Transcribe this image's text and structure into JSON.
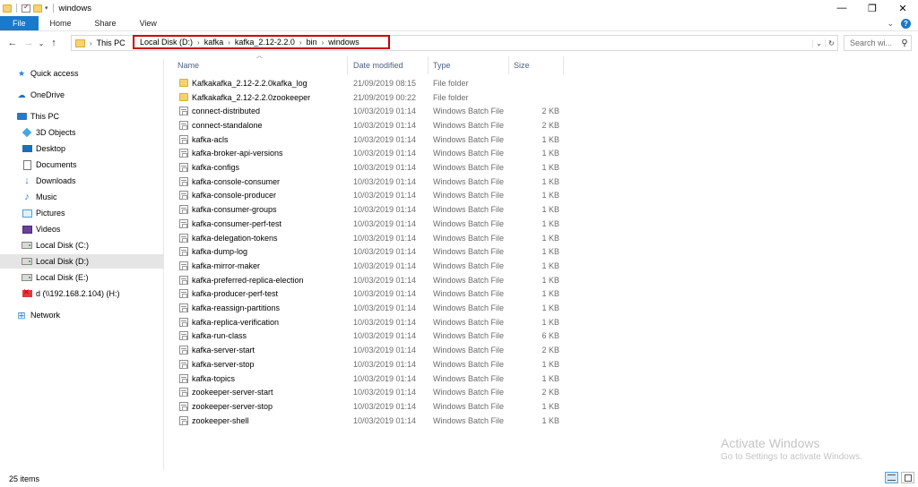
{
  "window": {
    "title": "windows",
    "controls": {
      "minimize": "—",
      "maximize": "❐",
      "close": "✕"
    }
  },
  "ribbon": {
    "tabs": [
      "File",
      "Home",
      "Share",
      "View"
    ],
    "expand": "⌄",
    "help": "?"
  },
  "nav": {
    "back": "←",
    "forward": "→",
    "recent": "⌄",
    "up": "↑"
  },
  "address": {
    "root": "This PC",
    "crumbs": [
      "Local Disk (D:)",
      "kafka",
      "kafka_2.12-2.2.0",
      "bin",
      "windows"
    ],
    "separator": "›",
    "dropdown": "⌄",
    "refresh": "↻",
    "highlight_color": "#cc0000"
  },
  "search": {
    "placeholder": "Search wi...",
    "icon": "search-icon"
  },
  "sidebar": {
    "items": [
      {
        "label": "Quick access",
        "icon": "star-icon"
      },
      {
        "label": "OneDrive",
        "icon": "cloud-icon"
      },
      {
        "label": "This PC",
        "icon": "computer-icon"
      },
      {
        "label": "3D Objects",
        "icon": "cube-icon"
      },
      {
        "label": "Desktop",
        "icon": "desktop-icon"
      },
      {
        "label": "Documents",
        "icon": "document-icon"
      },
      {
        "label": "Downloads",
        "icon": "download-icon"
      },
      {
        "label": "Music",
        "icon": "music-icon"
      },
      {
        "label": "Pictures",
        "icon": "picture-icon"
      },
      {
        "label": "Videos",
        "icon": "video-icon"
      },
      {
        "label": "Local Disk (C:)",
        "icon": "drive-icon"
      },
      {
        "label": "Local Disk (D:)",
        "icon": "drive-icon",
        "selected": true
      },
      {
        "label": "Local Disk (E:)",
        "icon": "drive-icon"
      },
      {
        "label": "d (\\\\192.168.2.104) (H:)",
        "icon": "network-drive-icon"
      },
      {
        "label": "Network",
        "icon": "network-icon"
      }
    ]
  },
  "columns": {
    "name": "Name",
    "date": "Date modified",
    "type": "Type",
    "size": "Size"
  },
  "files": [
    {
      "name": "Kafkakafka_2.12-2.2.0kafka_log",
      "date": "21/09/2019 08:15",
      "type": "File folder",
      "size": "",
      "icon": "folder-icon"
    },
    {
      "name": "Kafkakafka_2.12-2.2.0zookeeper",
      "date": "21/09/2019 00:22",
      "type": "File folder",
      "size": "",
      "icon": "folder-icon"
    },
    {
      "name": "connect-distributed",
      "date": "10/03/2019 01:14",
      "type": "Windows Batch File",
      "size": "2 KB",
      "icon": "batch-file-icon"
    },
    {
      "name": "connect-standalone",
      "date": "10/03/2019 01:14",
      "type": "Windows Batch File",
      "size": "2 KB",
      "icon": "batch-file-icon"
    },
    {
      "name": "kafka-acls",
      "date": "10/03/2019 01:14",
      "type": "Windows Batch File",
      "size": "1 KB",
      "icon": "batch-file-icon"
    },
    {
      "name": "kafka-broker-api-versions",
      "date": "10/03/2019 01:14",
      "type": "Windows Batch File",
      "size": "1 KB",
      "icon": "batch-file-icon"
    },
    {
      "name": "kafka-configs",
      "date": "10/03/2019 01:14",
      "type": "Windows Batch File",
      "size": "1 KB",
      "icon": "batch-file-icon"
    },
    {
      "name": "kafka-console-consumer",
      "date": "10/03/2019 01:14",
      "type": "Windows Batch File",
      "size": "1 KB",
      "icon": "batch-file-icon"
    },
    {
      "name": "kafka-console-producer",
      "date": "10/03/2019 01:14",
      "type": "Windows Batch File",
      "size": "1 KB",
      "icon": "batch-file-icon"
    },
    {
      "name": "kafka-consumer-groups",
      "date": "10/03/2019 01:14",
      "type": "Windows Batch File",
      "size": "1 KB",
      "icon": "batch-file-icon"
    },
    {
      "name": "kafka-consumer-perf-test",
      "date": "10/03/2019 01:14",
      "type": "Windows Batch File",
      "size": "1 KB",
      "icon": "batch-file-icon"
    },
    {
      "name": "kafka-delegation-tokens",
      "date": "10/03/2019 01:14",
      "type": "Windows Batch File",
      "size": "1 KB",
      "icon": "batch-file-icon"
    },
    {
      "name": "kafka-dump-log",
      "date": "10/03/2019 01:14",
      "type": "Windows Batch File",
      "size": "1 KB",
      "icon": "batch-file-icon"
    },
    {
      "name": "kafka-mirror-maker",
      "date": "10/03/2019 01:14",
      "type": "Windows Batch File",
      "size": "1 KB",
      "icon": "batch-file-icon"
    },
    {
      "name": "kafka-preferred-replica-election",
      "date": "10/03/2019 01:14",
      "type": "Windows Batch File",
      "size": "1 KB",
      "icon": "batch-file-icon"
    },
    {
      "name": "kafka-producer-perf-test",
      "date": "10/03/2019 01:14",
      "type": "Windows Batch File",
      "size": "1 KB",
      "icon": "batch-file-icon"
    },
    {
      "name": "kafka-reassign-partitions",
      "date": "10/03/2019 01:14",
      "type": "Windows Batch File",
      "size": "1 KB",
      "icon": "batch-file-icon"
    },
    {
      "name": "kafka-replica-verification",
      "date": "10/03/2019 01:14",
      "type": "Windows Batch File",
      "size": "1 KB",
      "icon": "batch-file-icon"
    },
    {
      "name": "kafka-run-class",
      "date": "10/03/2019 01:14",
      "type": "Windows Batch File",
      "size": "6 KB",
      "icon": "batch-file-icon"
    },
    {
      "name": "kafka-server-start",
      "date": "10/03/2019 01:14",
      "type": "Windows Batch File",
      "size": "2 KB",
      "icon": "batch-file-icon"
    },
    {
      "name": "kafka-server-stop",
      "date": "10/03/2019 01:14",
      "type": "Windows Batch File",
      "size": "1 KB",
      "icon": "batch-file-icon"
    },
    {
      "name": "kafka-topics",
      "date": "10/03/2019 01:14",
      "type": "Windows Batch File",
      "size": "1 KB",
      "icon": "batch-file-icon"
    },
    {
      "name": "zookeeper-server-start",
      "date": "10/03/2019 01:14",
      "type": "Windows Batch File",
      "size": "2 KB",
      "icon": "batch-file-icon"
    },
    {
      "name": "zookeeper-server-stop",
      "date": "10/03/2019 01:14",
      "type": "Windows Batch File",
      "size": "1 KB",
      "icon": "batch-file-icon"
    },
    {
      "name": "zookeeper-shell",
      "date": "10/03/2019 01:14",
      "type": "Windows Batch File",
      "size": "1 KB",
      "icon": "batch-file-icon"
    }
  ],
  "status": {
    "item_count": "25 items"
  },
  "watermark": {
    "title": "Activate Windows",
    "subtitle": "Go to Settings to activate Windows."
  }
}
